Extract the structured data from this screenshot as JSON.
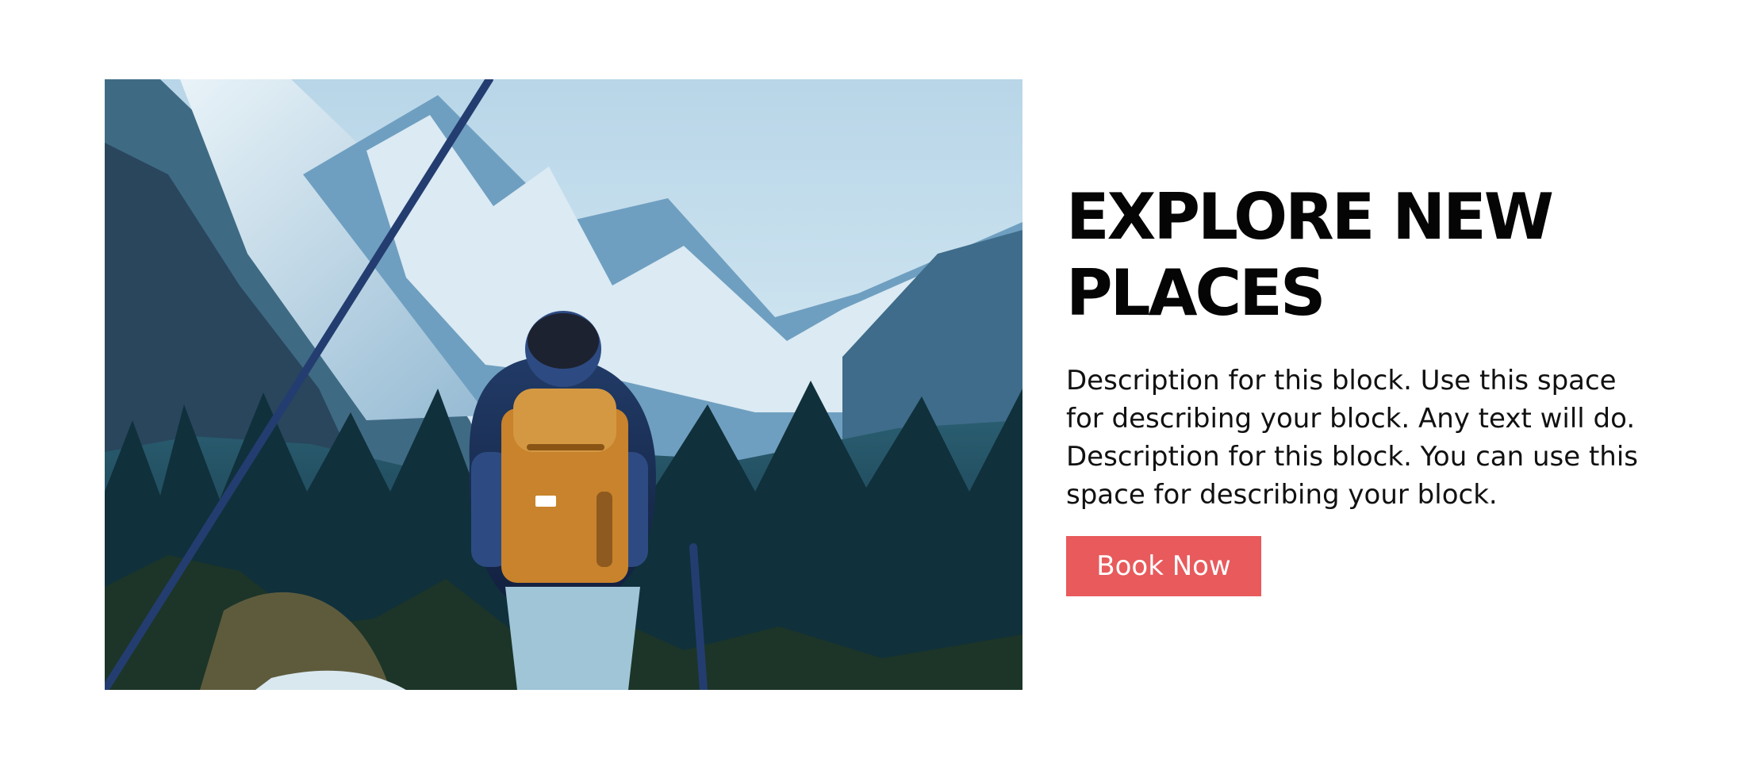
{
  "hero": {
    "headline": "EXPLORE NEW PLACES",
    "description": "Description for this block. Use this space for describing your block. Any text will do. Description for this block. You can use this space for describing your block.",
    "button_label": "Book Now"
  },
  "colors": {
    "button_background": "#e85a5c",
    "button_text": "#ffffff",
    "headline": "#050505",
    "description": "#111111"
  }
}
